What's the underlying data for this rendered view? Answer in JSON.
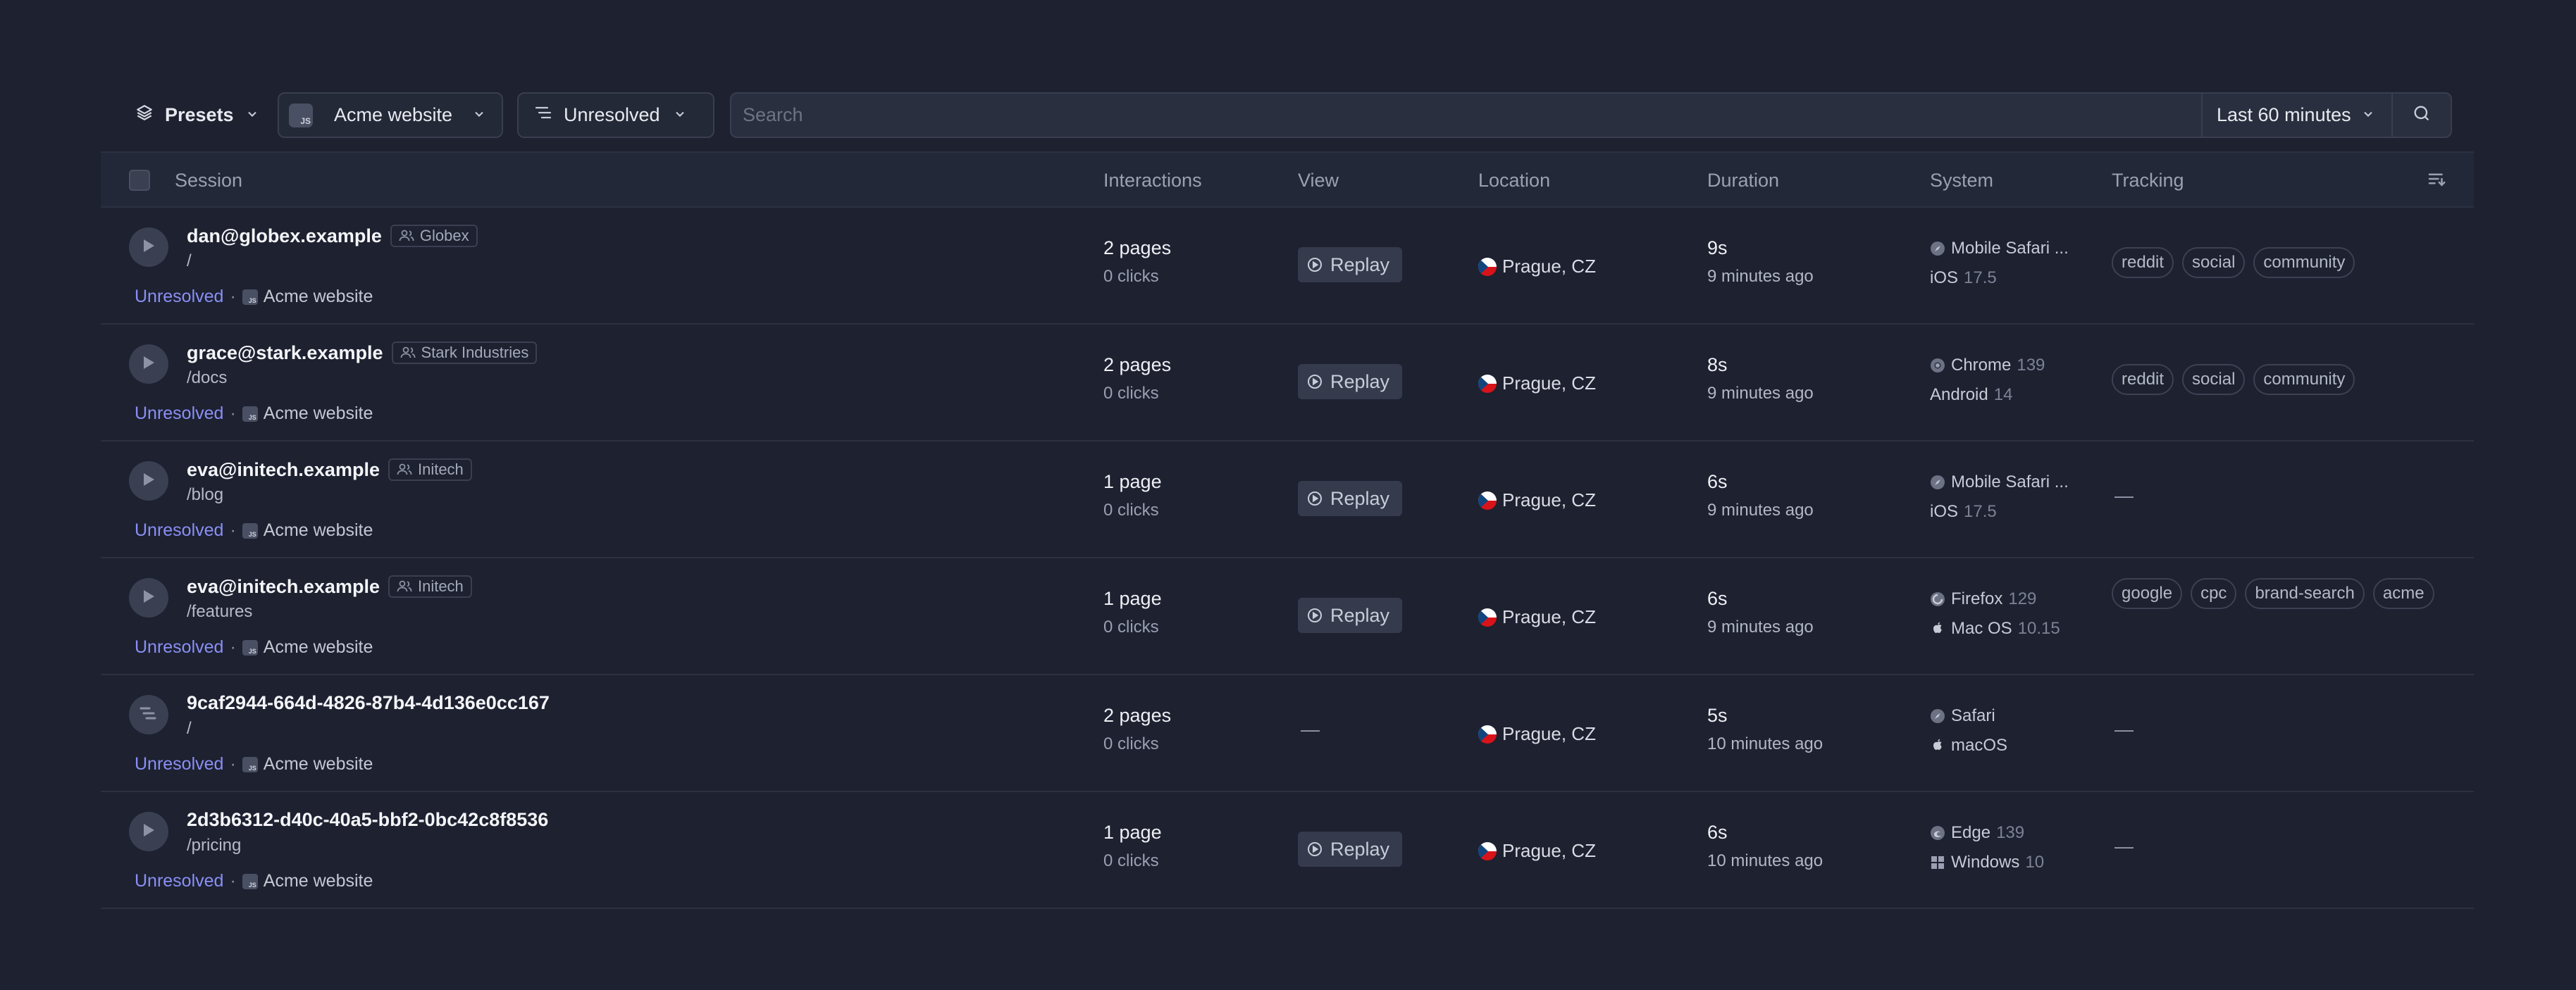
{
  "toolbar": {
    "presets_label": "Presets",
    "site_label": "Acme website",
    "site_icon_text": "JS",
    "status_label": "Unresolved",
    "search_placeholder": "Search",
    "range_label": "Last 60 minutes"
  },
  "table": {
    "columns": {
      "session": "Session",
      "interactions": "Interactions",
      "view": "View",
      "location": "Location",
      "duration": "Duration",
      "system": "System",
      "tracking": "Tracking"
    },
    "rows": [
      {
        "name": "dan@globex.example",
        "org": "Globex",
        "path": "/",
        "status": "Unresolved",
        "site": "Acme website",
        "pages": "2 pages",
        "clicks": "0 clicks",
        "view": "Replay",
        "location": "Prague, CZ",
        "duration": "9s",
        "ago": "9 minutes ago",
        "browser": "Mobile Safari ...",
        "browser_version": "",
        "os": "iOS",
        "os_version": "17.5",
        "tags": [
          "reddit",
          "social",
          "community"
        ]
      },
      {
        "name": "grace@stark.example",
        "org": "Stark Industries",
        "path": "/docs",
        "status": "Unresolved",
        "site": "Acme website",
        "pages": "2 pages",
        "clicks": "0 clicks",
        "view": "Replay",
        "location": "Prague, CZ",
        "duration": "8s",
        "ago": "9 minutes ago",
        "browser": "Chrome",
        "browser_version": "139",
        "os": "Android",
        "os_version": "14",
        "tags": [
          "reddit",
          "social",
          "community"
        ]
      },
      {
        "name": "eva@initech.example",
        "org": "Initech",
        "path": "/blog",
        "status": "Unresolved",
        "site": "Acme website",
        "pages": "1 page",
        "clicks": "0 clicks",
        "view": "Replay",
        "location": "Prague, CZ",
        "duration": "6s",
        "ago": "9 minutes ago",
        "browser": "Mobile Safari ...",
        "browser_version": "",
        "os": "iOS",
        "os_version": "17.5",
        "tracking_empty": "—"
      },
      {
        "name": "eva@initech.example",
        "org": "Initech",
        "path": "/features",
        "status": "Unresolved",
        "site": "Acme website",
        "pages": "1 page",
        "clicks": "0 clicks",
        "view": "Replay",
        "location": "Prague, CZ",
        "duration": "6s",
        "ago": "9 minutes ago",
        "browser": "Firefox",
        "browser_version": "129",
        "os": "Mac OS",
        "os_version": "10.15",
        "tags": [
          "google",
          "cpc",
          "brand-search",
          "acme"
        ]
      },
      {
        "name": "9caf2944-664d-4826-87b4-4d136e0cc167",
        "path": "/",
        "status": "Unresolved",
        "site": "Acme website",
        "pages": "2 pages",
        "clicks": "0 clicks",
        "view_empty": "—",
        "location": "Prague, CZ",
        "duration": "5s",
        "ago": "10 minutes ago",
        "browser": "Safari",
        "browser_version": "",
        "os": "macOS",
        "os_version": "",
        "tracking_empty": "—"
      },
      {
        "name": "2d3b6312-d40c-40a5-bbf2-0bc42c8f8536",
        "path": "/pricing",
        "status": "Unresolved",
        "site": "Acme website",
        "pages": "1 page",
        "clicks": "0 clicks",
        "view": "Replay",
        "location": "Prague, CZ",
        "duration": "6s",
        "ago": "10 minutes ago",
        "browser": "Edge",
        "browser_version": "139",
        "os": "Windows",
        "os_version": "10",
        "tracking_empty": "—"
      }
    ]
  },
  "meta_separator": "·",
  "colors": {
    "background": "#1d2130",
    "header_bg": "#232838",
    "status_unresolved": "#8a8ff5",
    "border": "#393e50"
  }
}
